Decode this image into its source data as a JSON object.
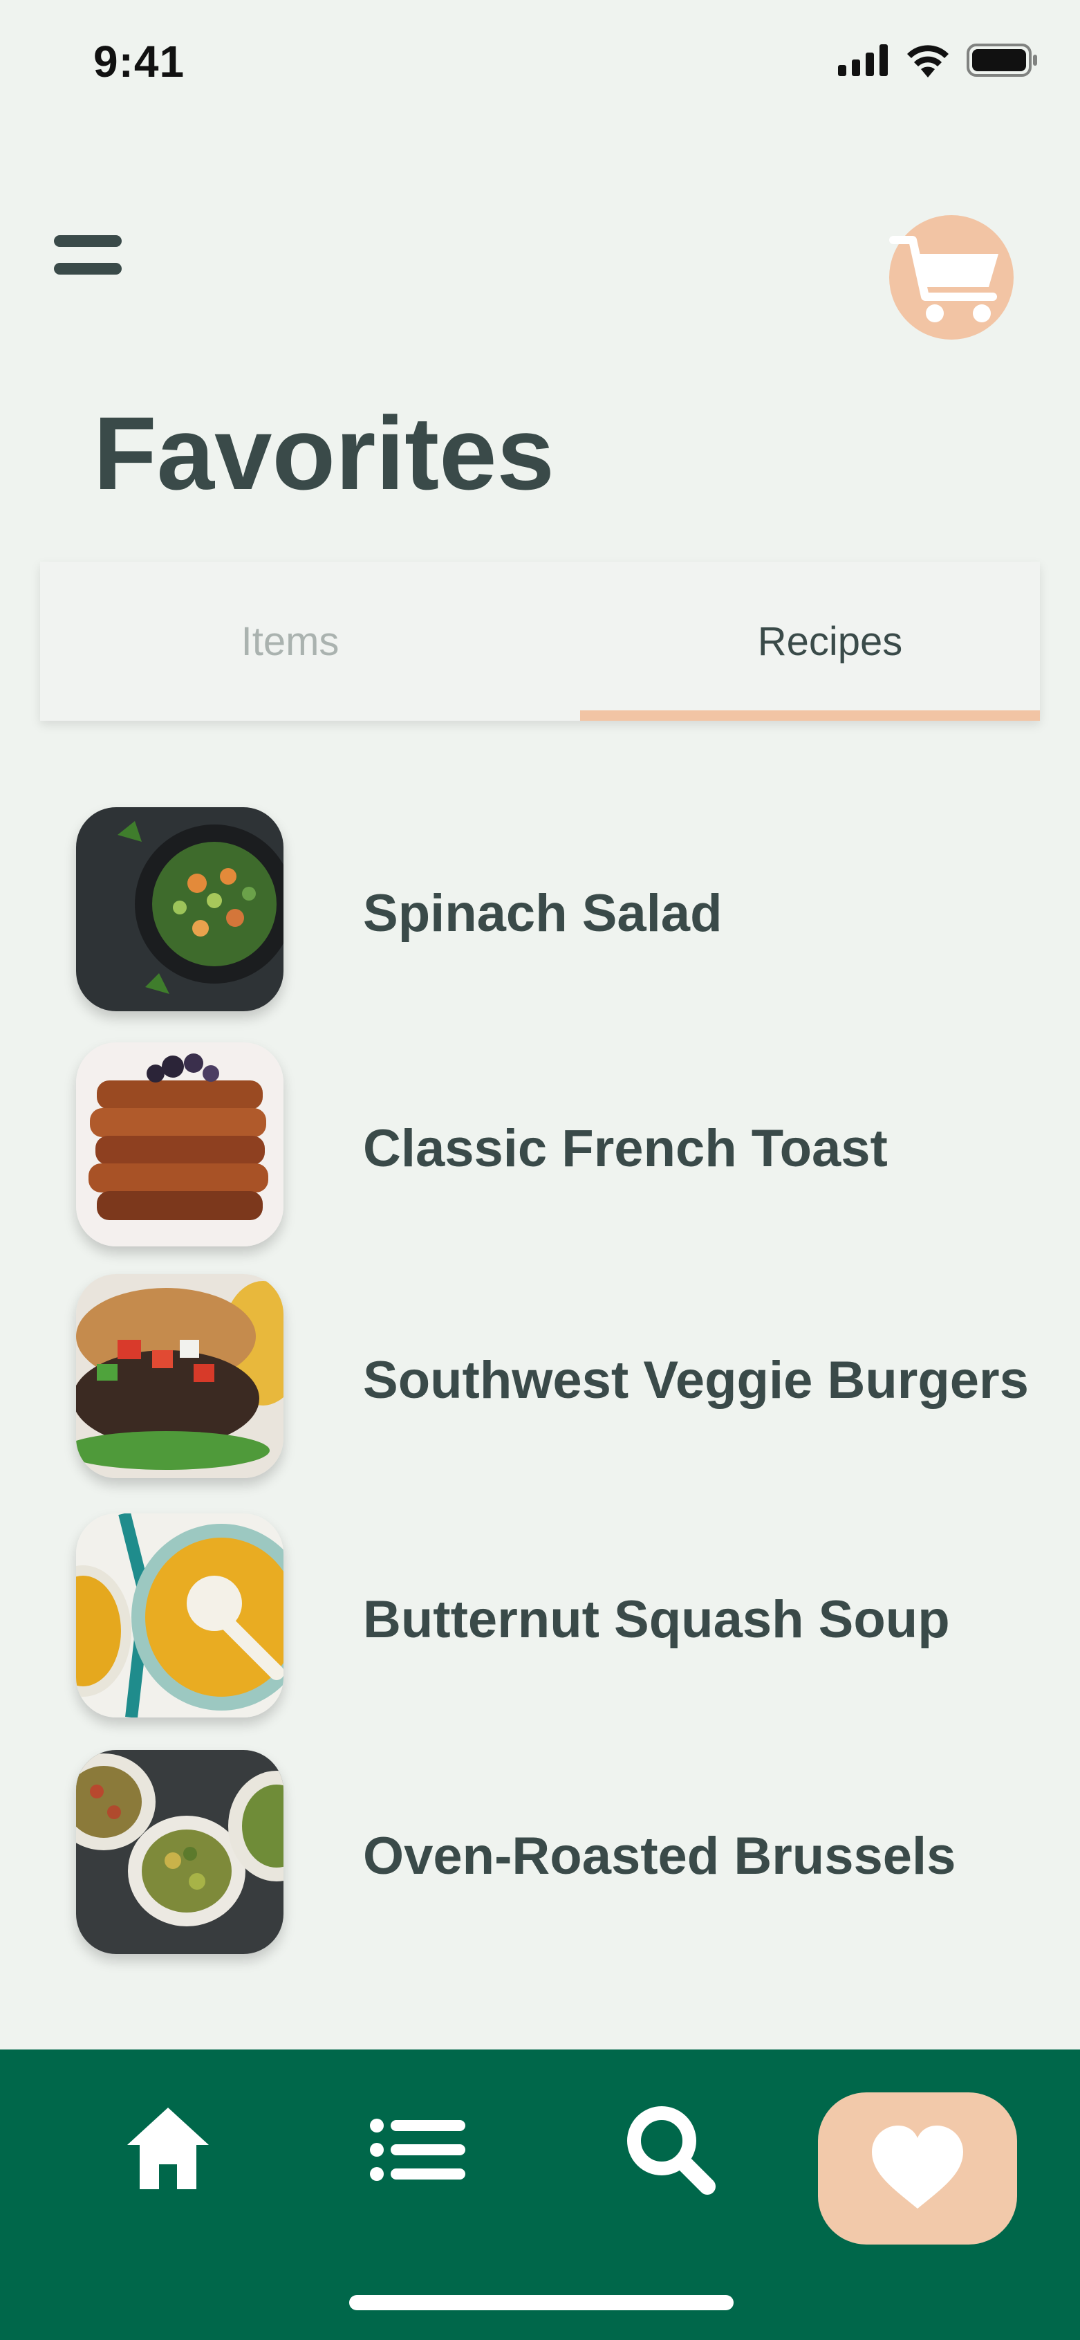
{
  "status_bar": {
    "time": "9:41"
  },
  "header": {
    "title": "Favorites"
  },
  "tabs": [
    {
      "label": "Items",
      "active": false
    },
    {
      "label": "Recipes",
      "active": true
    }
  ],
  "recipes": [
    {
      "name": "Spinach Salad"
    },
    {
      "name": "Classic French Toast"
    },
    {
      "name": "Southwest Veggie Burgers"
    },
    {
      "name": "Butternut Squash Soup"
    },
    {
      "name": "Oven-Roasted Brussels"
    }
  ],
  "bottom_nav": {
    "items": [
      "home-icon",
      "list-icon",
      "search-icon",
      "heart-icon"
    ],
    "active": "heart-icon"
  },
  "colors": {
    "background": "#EFF3EF",
    "text": "#3A4A49",
    "accent": "#F2C4A4",
    "nav": "#00674A"
  }
}
